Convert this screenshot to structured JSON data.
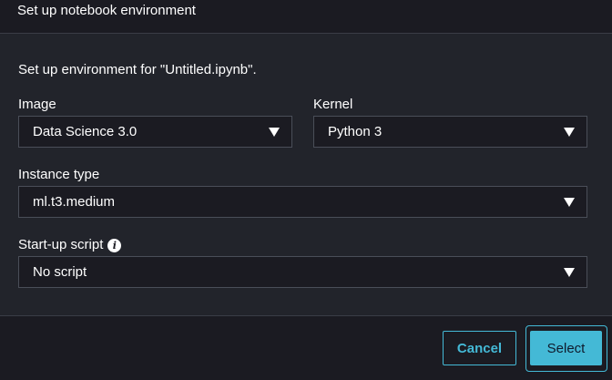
{
  "header": {
    "title": "Set up notebook environment"
  },
  "intro": "Set up environment for \"Untitled.ipynb\".",
  "fields": {
    "image": {
      "label": "Image",
      "value": "Data Science 3.0"
    },
    "kernel": {
      "label": "Kernel",
      "value": "Python 3"
    },
    "instance_type": {
      "label": "Instance type",
      "value": "ml.t3.medium"
    },
    "startup_script": {
      "label": "Start-up script",
      "value": "No script",
      "info_icon": "info-icon"
    }
  },
  "buttons": {
    "cancel": "Cancel",
    "select": "Select"
  },
  "colors": {
    "accent": "#44b9d6",
    "background": "#1b1b22",
    "panel": "#22242b"
  }
}
